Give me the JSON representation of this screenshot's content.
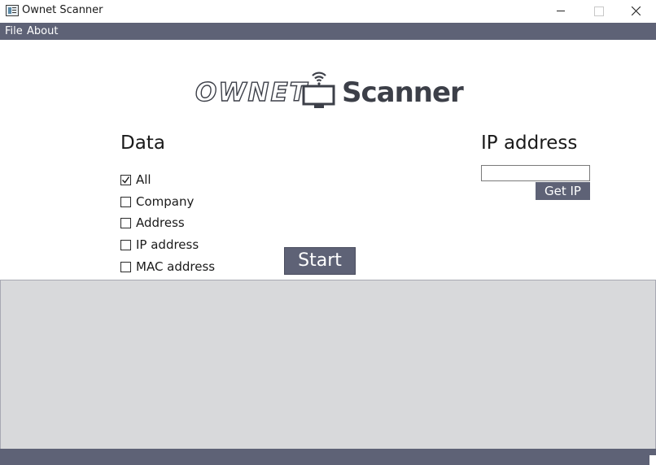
{
  "window": {
    "title": "Ownet Scanner"
  },
  "menu": {
    "items": [
      "File",
      "About"
    ]
  },
  "logo": {
    "part1": "OWNET",
    "part2": "Scanner"
  },
  "data_section": {
    "title": "Data",
    "options": [
      {
        "label": "All",
        "checked": true
      },
      {
        "label": "Company",
        "checked": false
      },
      {
        "label": "Address",
        "checked": false
      },
      {
        "label": "IP address",
        "checked": false
      },
      {
        "label": "MAC address",
        "checked": false
      }
    ]
  },
  "ip_section": {
    "title": "IP address",
    "input_value": "",
    "button_label": "Get IP"
  },
  "actions": {
    "start_label": "Start"
  },
  "colors": {
    "accent": "#5e6276",
    "logo": "#3c3f48",
    "results_bg": "#d8d9db"
  }
}
